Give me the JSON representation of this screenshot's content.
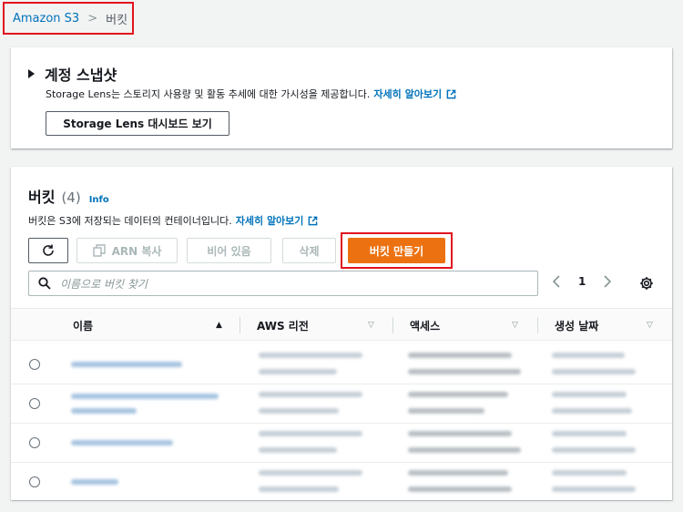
{
  "breadcrumb": {
    "root": "Amazon S3",
    "separator": ">",
    "current": "버킷"
  },
  "snapshot": {
    "title": "계정 스냅샷",
    "description": "Storage Lens는 스토리지 사용량 및 활동 추세에 대한 가시성을 제공합니다.",
    "learn_more": "자세히 알아보기",
    "dashboard_button": "Storage Lens 대시보드 보기"
  },
  "buckets": {
    "title": "버킷",
    "count": "(4)",
    "info": "Info",
    "description": "버킷은 S3에 저장되는 데이터의 컨테이너입니다.",
    "learn_more": "자세히 알아보기",
    "toolbar": {
      "arn_copy": "ARN 복사",
      "empty": "비어 있음",
      "delete": "삭제",
      "create": "버킷 만들기"
    },
    "search_placeholder": "이름으로 버킷 찾기",
    "page": "1",
    "columns": [
      "이름",
      "AWS 리전",
      "액세스",
      "생성 날짜"
    ]
  },
  "colors": {
    "accent": "#ec7211",
    "link": "#0073bb",
    "highlight": "#e0141e"
  }
}
